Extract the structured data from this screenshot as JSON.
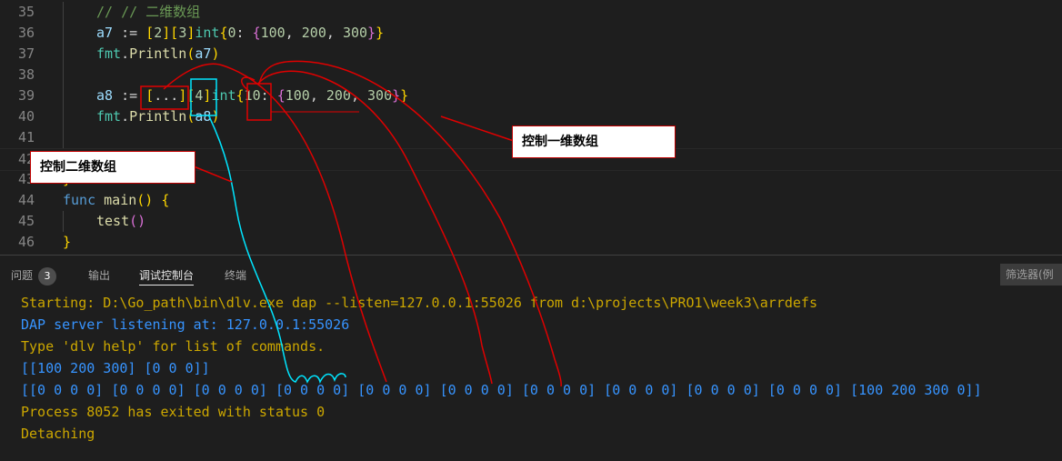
{
  "editor": {
    "lines": [
      {
        "num": "35",
        "tokens": [
          {
            "t": "// // 二维数组",
            "c": "cm"
          }
        ]
      },
      {
        "num": "36",
        "tokens": [
          {
            "t": "a7",
            "c": "id"
          },
          {
            "t": " := ",
            "c": "op"
          },
          {
            "t": "[",
            "c": "br1"
          },
          {
            "t": "2",
            "c": "nm"
          },
          {
            "t": "]",
            "c": "br1"
          },
          {
            "t": "[",
            "c": "br1"
          },
          {
            "t": "3",
            "c": "nm"
          },
          {
            "t": "]",
            "c": "br1"
          },
          {
            "t": "int",
            "c": "ty"
          },
          {
            "t": "{",
            "c": "br1"
          },
          {
            "t": "0",
            "c": "nm"
          },
          {
            "t": ": ",
            "c": "op"
          },
          {
            "t": "{",
            "c": "br2"
          },
          {
            "t": "100",
            "c": "nm"
          },
          {
            "t": ", ",
            "c": "op"
          },
          {
            "t": "200",
            "c": "nm"
          },
          {
            "t": ", ",
            "c": "op"
          },
          {
            "t": "300",
            "c": "nm"
          },
          {
            "t": "}",
            "c": "br2"
          },
          {
            "t": "}",
            "c": "br1"
          }
        ]
      },
      {
        "num": "37",
        "tokens": [
          {
            "t": "fmt",
            "c": "ty"
          },
          {
            "t": ".",
            "c": "op"
          },
          {
            "t": "Println",
            "c": "fn"
          },
          {
            "t": "(",
            "c": "br1"
          },
          {
            "t": "a7",
            "c": "id"
          },
          {
            "t": ")",
            "c": "br1"
          }
        ]
      },
      {
        "num": "38",
        "tokens": []
      },
      {
        "num": "39",
        "tokens": [
          {
            "t": "a8",
            "c": "id"
          },
          {
            "t": " := ",
            "c": "op"
          },
          {
            "t": "[",
            "c": "br1"
          },
          {
            "t": "...",
            "c": "op"
          },
          {
            "t": "]",
            "c": "br1"
          },
          {
            "t": "[",
            "c": "br1"
          },
          {
            "t": "4",
            "c": "nm"
          },
          {
            "t": "]",
            "c": "br1"
          },
          {
            "t": "int",
            "c": "ty"
          },
          {
            "t": "{",
            "c": "br1"
          },
          {
            "t": "10",
            "c": "nm"
          },
          {
            "t": ": ",
            "c": "op"
          },
          {
            "t": "{",
            "c": "br2"
          },
          {
            "t": "100",
            "c": "nm"
          },
          {
            "t": ", ",
            "c": "op"
          },
          {
            "t": "200",
            "c": "nm"
          },
          {
            "t": ", ",
            "c": "op"
          },
          {
            "t": "300",
            "c": "nm"
          },
          {
            "t": "}",
            "c": "br2"
          },
          {
            "t": "}",
            "c": "br1"
          }
        ]
      },
      {
        "num": "40",
        "tokens": [
          {
            "t": "fmt",
            "c": "ty"
          },
          {
            "t": ".",
            "c": "op"
          },
          {
            "t": "Println",
            "c": "fn"
          },
          {
            "t": "(",
            "c": "br1"
          },
          {
            "t": "a8",
            "c": "id"
          },
          {
            "t": ")",
            "c": "br1"
          }
        ]
      },
      {
        "num": "41",
        "tokens": []
      },
      {
        "num": "42",
        "tokens": []
      },
      {
        "num": "43",
        "tokens": [
          {
            "t": "}",
            "c": "br1"
          }
        ]
      },
      {
        "num": "44",
        "tokens": [
          {
            "t": "func",
            "c": "kw"
          },
          {
            "t": " ",
            "c": "op"
          },
          {
            "t": "main",
            "c": "fn"
          },
          {
            "t": "()",
            "c": "br1"
          },
          {
            "t": " ",
            "c": "op"
          },
          {
            "t": "{",
            "c": "br1"
          }
        ]
      },
      {
        "num": "45",
        "tokens": [
          {
            "t": "test",
            "c": "fn"
          },
          {
            "t": "()",
            "c": "br2"
          }
        ]
      },
      {
        "num": "46",
        "tokens": [
          {
            "t": "}",
            "c": "br1"
          }
        ]
      }
    ]
  },
  "panel": {
    "tabs": [
      {
        "label": "问题",
        "badge": "3"
      },
      {
        "label": "输出"
      },
      {
        "label": "调试控制台",
        "active": true
      },
      {
        "label": "终端"
      }
    ],
    "filter_placeholder": "筛选器(例",
    "output": [
      {
        "text": "Starting: D:\\Go_path\\bin\\dlv.exe dap --listen=127.0.0.1:55026 from d:\\projects\\PRO1\\week3\\arrdefs",
        "color": "orange"
      },
      {
        "text": "DAP server listening at: 127.0.0.1:55026",
        "color": "blue"
      },
      {
        "text": "Type 'dlv help' for list of commands.",
        "color": "orange"
      },
      {
        "text": "[[100 200 300] [0 0 0]]",
        "color": "blue"
      },
      {
        "text": "[[0 0 0 0] [0 0 0 0] [0 0 0 0] [0 0 0 0] [0 0 0 0] [0 0 0 0] [0 0 0 0] [0 0 0 0] [0 0 0 0] [0 0 0 0] [100 200 300 0]]",
        "color": "blue"
      },
      {
        "text": "Process 8052 has exited with status 0",
        "color": "orange"
      },
      {
        "text": "Detaching",
        "color": "orange"
      }
    ]
  },
  "annotations": {
    "callout_1d": "控制一维数组",
    "callout_2d": "控制二维数组"
  }
}
